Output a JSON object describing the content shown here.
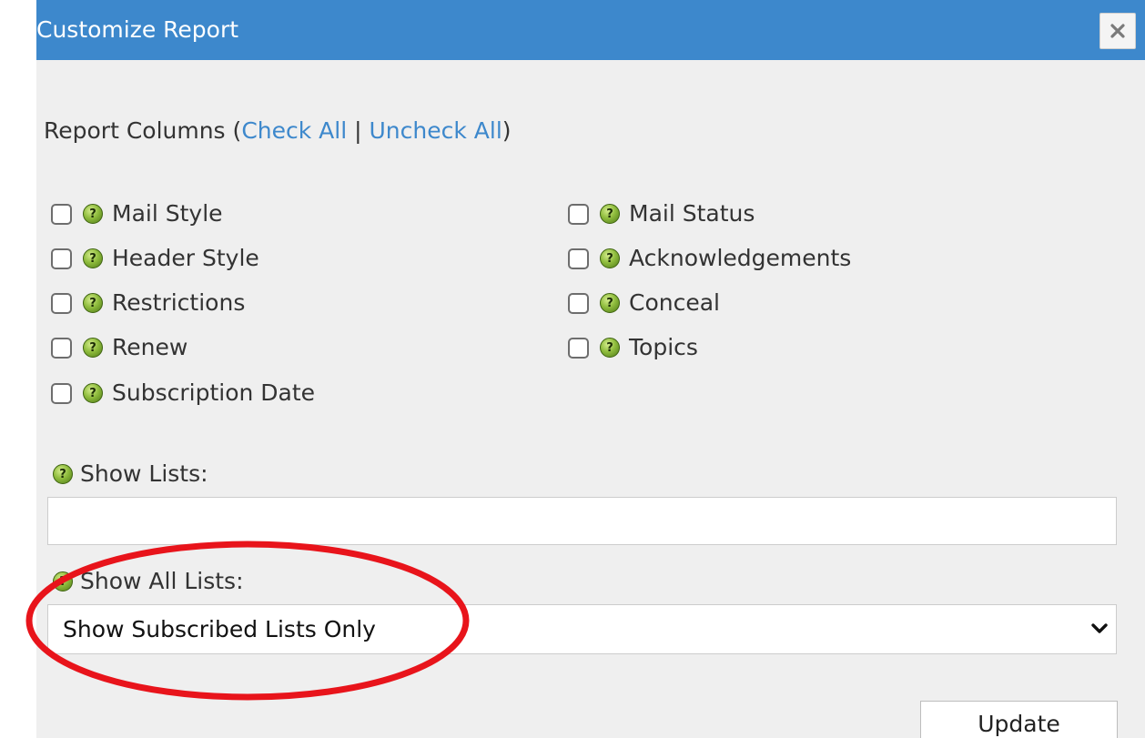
{
  "dialog": {
    "title": "Customize Report",
    "close_icon": "close-x-icon"
  },
  "report_columns": {
    "label": "Report Columns",
    "paren_open": "(",
    "check_all": "Check All",
    "separator": " | ",
    "uncheck_all": "Uncheck All",
    "paren_close": ")"
  },
  "columns": {
    "left": [
      {
        "label": "Mail Style",
        "checked": false
      },
      {
        "label": "Header Style",
        "checked": false
      },
      {
        "label": "Restrictions",
        "checked": false
      },
      {
        "label": "Renew",
        "checked": false
      },
      {
        "label": "Subscription Date",
        "checked": false
      }
    ],
    "right": [
      {
        "label": "Mail Status",
        "checked": false
      },
      {
        "label": "Acknowledgements",
        "checked": false
      },
      {
        "label": "Conceal",
        "checked": false
      },
      {
        "label": "Topics",
        "checked": false
      }
    ]
  },
  "show_lists": {
    "label": "Show Lists:",
    "value": ""
  },
  "show_all_lists": {
    "label": "Show All Lists:",
    "selected": "Show Subscribed Lists Only"
  },
  "update_button": {
    "label": "Update"
  },
  "colors": {
    "titlebar": "#3d88cc",
    "link": "#3d88cc",
    "background": "#efefef",
    "annotation": "#e8141b"
  },
  "icons": {
    "help": "help-question-icon",
    "chevron": "chevron-down-icon"
  }
}
